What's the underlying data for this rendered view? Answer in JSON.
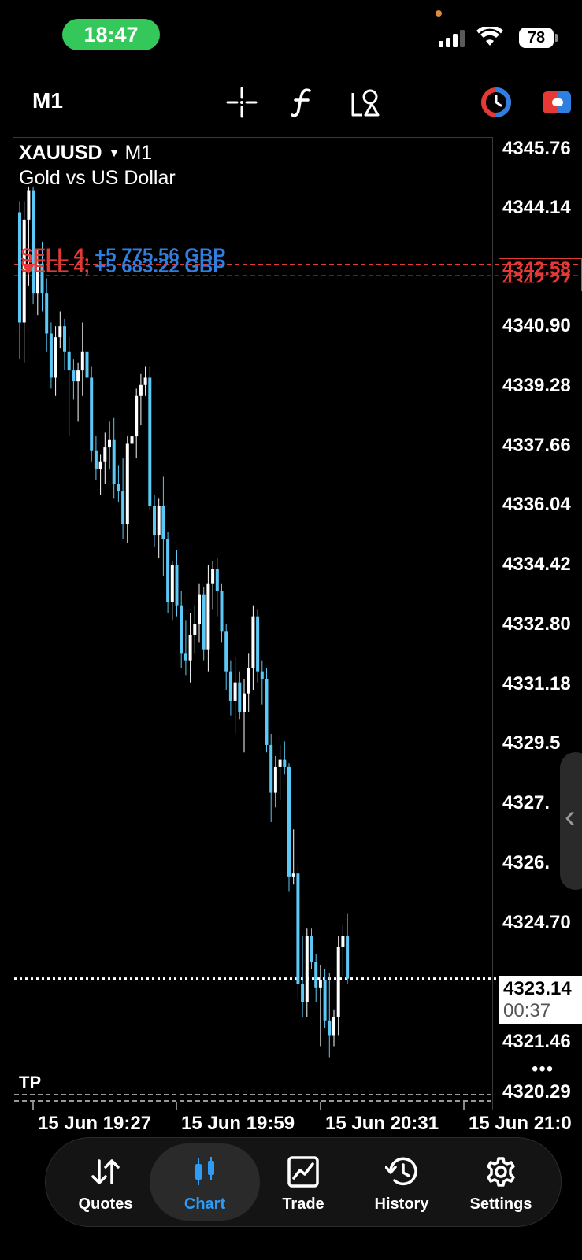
{
  "status_bar": {
    "time": "18:47",
    "battery": "78"
  },
  "toolbar": {
    "timeframe": "M1",
    "tools": [
      "crosshair-icon",
      "indicators-icon",
      "objects-icon",
      "trade-window-icon",
      "one-click-trading-icon"
    ]
  },
  "chart": {
    "symbol": "XAUUSD",
    "symbol_timeframe": "M1",
    "description": "Gold vs US Dollar",
    "price_scale": [
      "4345.76",
      "4344.14",
      "4340.90",
      "4339.28",
      "4337.66",
      "4336.04",
      "4334.42",
      "4332.80",
      "4331.18",
      "4329.5",
      "4327.",
      "4326.",
      "4324.70",
      "4321.46",
      "4320.29"
    ],
    "time_scale": [
      "15 Jun 19:27",
      "15 Jun 19:59",
      "15 Jun 20:31",
      "15 Jun 21:0"
    ],
    "orders": [
      {
        "side": "SELL 4,",
        "profit": "+5 775.56 GBP",
        "price_tag": "4342.58"
      },
      {
        "side": "SELL 4,",
        "profit": "+5 683.22 GBP",
        "price_tag": "4342.27"
      }
    ],
    "current_price": "4323.14",
    "countdown": "00:37",
    "tp_label": "TP",
    "colors": {
      "bull": "#ffffff",
      "bear": "#5bc8f5",
      "sell": "#e53935",
      "profit": "#2f7fe0"
    }
  },
  "chart_data": {
    "type": "candlestick",
    "symbol": "XAUUSD",
    "timeframe": "M1",
    "ohlc": [
      [
        4344.0,
        4344.3,
        4340.0,
        4341.0
      ],
      [
        4341.0,
        4344.3,
        4339.9,
        4343.8
      ],
      [
        4343.8,
        4344.7,
        4342.0,
        4344.6
      ],
      [
        4344.6,
        4344.7,
        4341.5,
        4341.8
      ],
      [
        4341.8,
        4343.0,
        4341.2,
        4342.6
      ],
      [
        4342.6,
        4343.2,
        4341.3,
        4341.8
      ],
      [
        4341.8,
        4342.2,
        4340.2,
        4340.7
      ],
      [
        4340.7,
        4341.0,
        4339.2,
        4339.5
      ],
      [
        4339.5,
        4340.9,
        4339.0,
        4340.6
      ],
      [
        4340.6,
        4341.3,
        4340.3,
        4340.9
      ],
      [
        4340.9,
        4341.1,
        4339.7,
        4340.2
      ],
      [
        4340.2,
        4340.6,
        4337.9,
        4339.7
      ],
      [
        4339.7,
        4340.0,
        4338.9,
        4339.4
      ],
      [
        4339.4,
        4339.9,
        4338.3,
        4339.7
      ],
      [
        4339.7,
        4341.0,
        4339.0,
        4340.2
      ],
      [
        4340.2,
        4340.8,
        4339.3,
        4339.5
      ],
      [
        4339.5,
        4339.8,
        4337.2,
        4337.5
      ],
      [
        4337.5,
        4337.9,
        4336.7,
        4337.0
      ],
      [
        4337.0,
        4337.4,
        4336.3,
        4337.2
      ],
      [
        4337.2,
        4338.0,
        4336.6,
        4337.6
      ],
      [
        4337.6,
        4338.3,
        4337.0,
        4337.8
      ],
      [
        4337.8,
        4338.4,
        4336.2,
        4336.6
      ],
      [
        4336.6,
        4337.1,
        4336.1,
        4336.4
      ],
      [
        4336.4,
        4337.3,
        4335.1,
        4335.5
      ],
      [
        4335.5,
        4337.9,
        4335.0,
        4337.7
      ],
      [
        4337.7,
        4338.9,
        4337.0,
        4337.9
      ],
      [
        4337.9,
        4339.2,
        4337.3,
        4339.0
      ],
      [
        4339.0,
        4339.6,
        4338.2,
        4339.3
      ],
      [
        4339.3,
        4339.8,
        4339.0,
        4339.5
      ],
      [
        4339.5,
        4339.8,
        4335.9,
        4336.0
      ],
      [
        4336.0,
        4336.3,
        4334.9,
        4335.2
      ],
      [
        4335.2,
        4336.2,
        4334.6,
        4336.0
      ],
      [
        4336.0,
        4336.8,
        4334.1,
        4335.1
      ],
      [
        4335.1,
        4335.3,
        4333.1,
        4333.4
      ],
      [
        4333.4,
        4334.5,
        4332.9,
        4334.4
      ],
      [
        4334.4,
        4334.8,
        4333.0,
        4333.3
      ],
      [
        4333.3,
        4333.7,
        4331.6,
        4332.0
      ],
      [
        4332.0,
        4332.9,
        4331.4,
        4331.8
      ],
      [
        4331.8,
        4333.1,
        4331.2,
        4332.5
      ],
      [
        4332.5,
        4333.3,
        4332.0,
        4332.8
      ],
      [
        4332.8,
        4333.9,
        4332.3,
        4333.6
      ],
      [
        4333.6,
        4333.8,
        4331.8,
        4332.1
      ],
      [
        4332.1,
        4334.4,
        4331.5,
        4333.9
      ],
      [
        4333.9,
        4334.5,
        4333.2,
        4334.3
      ],
      [
        4334.3,
        4334.6,
        4333.0,
        4333.7
      ],
      [
        4333.7,
        4333.9,
        4332.3,
        4332.6
      ],
      [
        4332.6,
        4332.8,
        4331.0,
        4331.5
      ],
      [
        4331.5,
        4331.8,
        4330.3,
        4330.7
      ],
      [
        4330.7,
        4331.9,
        4329.8,
        4331.2
      ],
      [
        4331.2,
        4331.5,
        4330.2,
        4330.4
      ],
      [
        4330.4,
        4331.3,
        4329.3,
        4330.9
      ],
      [
        4330.9,
        4332.0,
        4330.4,
        4331.6
      ],
      [
        4331.6,
        4333.3,
        4331.0,
        4333.0
      ],
      [
        4333.0,
        4333.2,
        4331.2,
        4331.5
      ],
      [
        4331.5,
        4331.8,
        4330.6,
        4331.3
      ],
      [
        4331.3,
        4331.6,
        4329.3,
        4329.5
      ],
      [
        4329.5,
        4329.8,
        4327.4,
        4328.2
      ],
      [
        4328.2,
        4329.2,
        4327.8,
        4328.9
      ],
      [
        4328.9,
        4329.5,
        4328.0,
        4329.1
      ],
      [
        4329.1,
        4329.6,
        4328.7,
        4328.9
      ],
      [
        4328.9,
        4329.0,
        4325.5,
        4325.9
      ],
      [
        4325.9,
        4327.2,
        4325.7,
        4326.0
      ],
      [
        4326.0,
        4326.2,
        4322.6,
        4323.0
      ],
      [
        4323.0,
        4324.3,
        4322.1,
        4322.5
      ],
      [
        4322.5,
        4324.5,
        4322.1,
        4324.3
      ],
      [
        4324.3,
        4324.5,
        4323.4,
        4323.6
      ],
      [
        4323.6,
        4323.8,
        4322.5,
        4322.9
      ],
      [
        4322.9,
        4323.5,
        4321.3,
        4323.1
      ],
      [
        4323.1,
        4323.4,
        4321.8,
        4322.0
      ],
      [
        4322.0,
        4323.3,
        4321.0,
        4321.6
      ],
      [
        4321.6,
        4322.3,
        4321.3,
        4322.1
      ],
      [
        4322.1,
        4324.3,
        4321.6,
        4324.0
      ],
      [
        4324.0,
        4324.6,
        4323.2,
        4324.3
      ],
      [
        4324.3,
        4324.9,
        4323.0,
        4323.14
      ]
    ]
  },
  "nav": [
    {
      "label": "Quotes",
      "icon": "quotes-icon",
      "active": false
    },
    {
      "label": "Chart",
      "icon": "chart-icon",
      "active": true
    },
    {
      "label": "Trade",
      "icon": "trade-icon",
      "active": false
    },
    {
      "label": "History",
      "icon": "history-icon",
      "active": false
    },
    {
      "label": "Settings",
      "icon": "settings-icon",
      "active": false
    }
  ],
  "theme": {
    "accent": "#2f9bf5",
    "background": "#000000"
  }
}
